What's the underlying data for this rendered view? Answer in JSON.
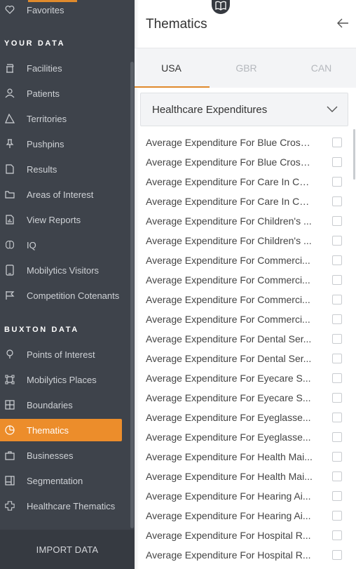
{
  "sidebar": {
    "favorites_label": "Favorites",
    "section_your_data": "YOUR DATA",
    "your_data_items": [
      {
        "label": "Facilities",
        "icon": "facility-icon"
      },
      {
        "label": "Patients",
        "icon": "person-icon"
      },
      {
        "label": "Territories",
        "icon": "territory-icon"
      },
      {
        "label": "Pushpins",
        "icon": "pushpin-icon"
      },
      {
        "label": "Results",
        "icon": "document-icon"
      },
      {
        "label": "Areas of Interest",
        "icon": "folder-icon"
      },
      {
        "label": "View Reports",
        "icon": "report-icon"
      },
      {
        "label": "IQ",
        "icon": "brain-icon"
      },
      {
        "label": "Mobilytics Visitors",
        "icon": "phone-icon"
      },
      {
        "label": "Competition Cotenants",
        "icon": "flag-icon"
      }
    ],
    "section_buxton_data": "BUXTON DATA",
    "buxton_items": [
      {
        "label": "Points of Interest",
        "icon": "map-pin-icon"
      },
      {
        "label": "Mobilytics Places",
        "icon": "places-icon"
      },
      {
        "label": "Boundaries",
        "icon": "grid-icon"
      },
      {
        "label": "Thematics",
        "icon": "thematics-icon",
        "active": true
      },
      {
        "label": "Businesses",
        "icon": "briefcase-icon"
      },
      {
        "label": "Segmentation",
        "icon": "segmentation-icon"
      },
      {
        "label": "Healthcare Thematics",
        "icon": "healthcare-icon"
      }
    ],
    "import_label": "IMPORT DATA"
  },
  "panel": {
    "title": "Thematics",
    "tabs": [
      {
        "label": "USA",
        "active": true
      },
      {
        "label": "GBR",
        "active": false
      },
      {
        "label": "CAN",
        "active": false
      }
    ],
    "category": "Healthcare Expenditures",
    "rows": [
      "Average Expenditure For Blue Cross...",
      "Average Expenditure For Blue Cross...",
      "Average Expenditure For Care In Co...",
      "Average Expenditure For Care In Co...",
      "Average Expenditure For Children's ...",
      "Average Expenditure For Children's ...",
      "Average Expenditure For Commerci...",
      "Average Expenditure For Commerci...",
      "Average Expenditure For Commerci...",
      "Average Expenditure For Commerci...",
      "Average Expenditure For Dental Ser...",
      "Average Expenditure For Dental Ser...",
      "Average Expenditure For Eyecare S...",
      "Average Expenditure For Eyecare S...",
      "Average Expenditure For Eyeglasse...",
      "Average Expenditure For Eyeglasse...",
      "Average Expenditure For Health Mai...",
      "Average Expenditure For Health Mai...",
      "Average Expenditure For Hearing Ai...",
      "Average Expenditure For Hearing Ai...",
      "Average Expenditure For Hospital R...",
      "Average Expenditure For Hospital R..."
    ]
  },
  "colors": {
    "sidebar_bg": "#3e434b",
    "accent": "#ec8d2b",
    "panel_bg": "#ffffff",
    "tabs_bg": "#f3f4f6"
  }
}
